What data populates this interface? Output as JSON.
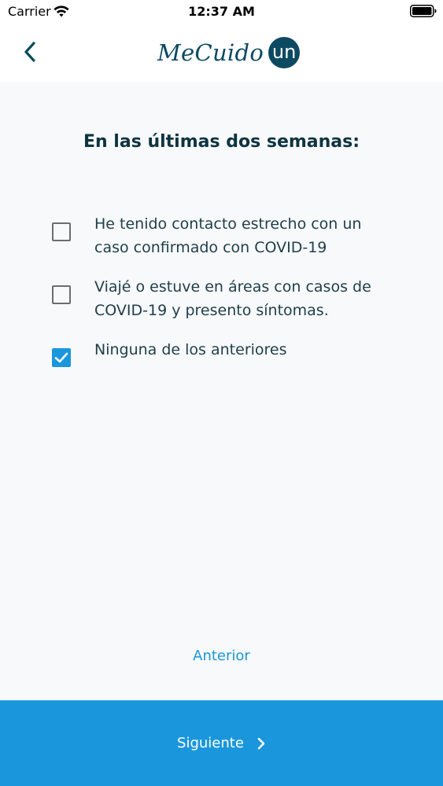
{
  "status_bar": {
    "carrier": "Carrier",
    "time": "12:37 AM",
    "wifi_icon": "wifi-icon",
    "battery_icon": "battery-icon"
  },
  "nav": {
    "back_icon": "chevron-left-icon",
    "logo_text": "MeCuido",
    "logo_badge": "un"
  },
  "question": {
    "title": "En las últimas dos semanas:",
    "options": [
      {
        "label": "He tenido contacto estrecho con un caso confirmado con COVID-19",
        "checked": false
      },
      {
        "label": "Viajé o estuve en áreas con casos de COVID-19 y presento síntomas.",
        "checked": false
      },
      {
        "label": "Ninguna de los anteriores",
        "checked": true
      }
    ]
  },
  "footer": {
    "previous_label": "Anterior",
    "next_label": "Siguiente",
    "next_icon": "chevron-right-icon"
  },
  "colors": {
    "brand_dark": "#0d4a62",
    "accent": "#1a97dc",
    "background": "#f7f9fb",
    "text": "#1f3e49"
  }
}
